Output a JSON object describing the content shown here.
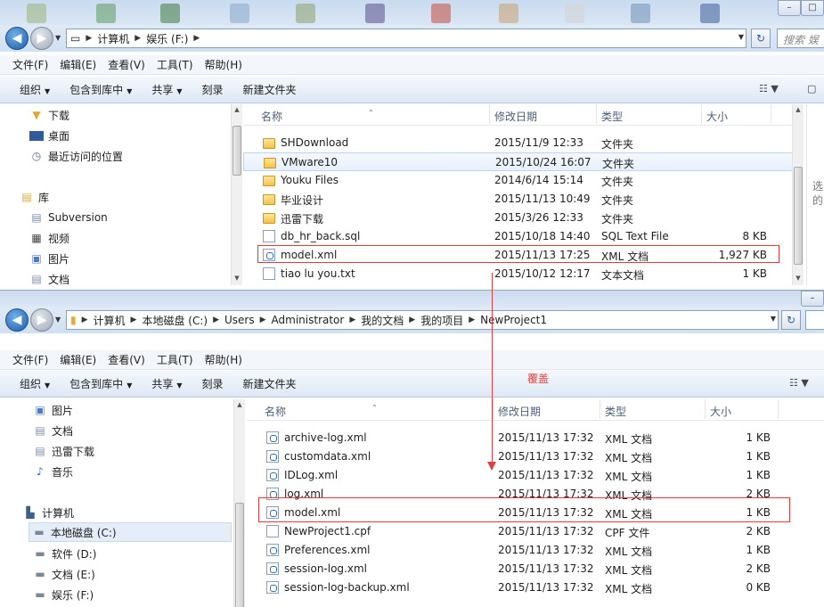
{
  "window1": {
    "address": [
      "计算机",
      "娱乐 (F:)"
    ],
    "search_placeholder": "搜索 娱",
    "menu": [
      "文件(F)",
      "编辑(E)",
      "查看(V)",
      "工具(T)",
      "帮助(H)"
    ],
    "toolbar": {
      "organize": "组织",
      "include": "包含到库中",
      "share": "共享",
      "burn": "刻录",
      "new_folder": "新建文件夹"
    },
    "nav_items": [
      {
        "label": "下载",
        "icon": "download-folder-icon"
      },
      {
        "label": "桌面",
        "icon": "desktop-icon"
      },
      {
        "label": "最近访问的位置",
        "icon": "recent-places-icon"
      },
      {
        "label": "库",
        "icon": "library-icon"
      },
      {
        "label": "Subversion",
        "icon": "document-library-icon"
      },
      {
        "label": "视频",
        "icon": "video-library-icon"
      },
      {
        "label": "图片",
        "icon": "picture-library-icon"
      },
      {
        "label": "文档",
        "icon": "document-library-icon"
      }
    ],
    "columns": {
      "name": "名称",
      "modified": "修改日期",
      "type": "类型",
      "size": "大小"
    },
    "files": [
      {
        "name": "SHDownload",
        "modified": "2015/11/9 12:33",
        "type": "文件夹",
        "size": "",
        "kind": "folder"
      },
      {
        "name": "VMware10",
        "modified": "2015/10/24 16:07",
        "type": "文件夹",
        "size": "",
        "kind": "folder"
      },
      {
        "name": "Youku Files",
        "modified": "2014/6/14 15:14",
        "type": "文件夹",
        "size": "",
        "kind": "folder"
      },
      {
        "name": "毕业设计",
        "modified": "2015/11/13 10:49",
        "type": "文件夹",
        "size": "",
        "kind": "folder"
      },
      {
        "name": "迅雷下载",
        "modified": "2015/3/26 12:33",
        "type": "文件夹",
        "size": "",
        "kind": "folder"
      },
      {
        "name": "db_hr_back.sql",
        "modified": "2015/10/18 14:40",
        "type": "SQL Text File",
        "size": "8 KB",
        "kind": "doc"
      },
      {
        "name": "model.xml",
        "modified": "2015/11/13 17:25",
        "type": "XML 文档",
        "size": "1,927 KB",
        "kind": "xml"
      },
      {
        "name": "tiao lu you.txt",
        "modified": "2015/10/12 12:17",
        "type": "文本文档",
        "size": "1 KB",
        "kind": "doc"
      }
    ],
    "right_pane_text": [
      "选",
      "的"
    ]
  },
  "window2": {
    "address": [
      "计算机",
      "本地磁盘 (C:)",
      "Users",
      "Administrator",
      "我的文档",
      "我的项目",
      "NewProject1"
    ],
    "menu": [
      "文件(F)",
      "编辑(E)",
      "查看(V)",
      "工具(T)",
      "帮助(H)"
    ],
    "toolbar": {
      "organize": "组织",
      "include": "包含到库中",
      "share": "共享",
      "burn": "刻录",
      "new_folder": "新建文件夹"
    },
    "nav_items": [
      {
        "label": "图片",
        "icon": "picture-library-icon"
      },
      {
        "label": "文档",
        "icon": "document-library-icon"
      },
      {
        "label": "迅雷下载",
        "icon": "document-library-icon"
      },
      {
        "label": "音乐",
        "icon": "music-library-icon"
      },
      {
        "label": "计算机",
        "icon": "computer-icon"
      },
      {
        "label": "本地磁盘 (C:)",
        "icon": "system-drive-icon"
      },
      {
        "label": "软件 (D:)",
        "icon": "drive-icon"
      },
      {
        "label": "文档 (E:)",
        "icon": "drive-icon"
      },
      {
        "label": "娱乐 (F:)",
        "icon": "drive-icon"
      }
    ],
    "columns": {
      "name": "名称",
      "modified": "修改日期",
      "type": "类型",
      "size": "大小"
    },
    "files": [
      {
        "name": "archive-log.xml",
        "modified": "2015/11/13 17:32",
        "type": "XML 文档",
        "size": "1 KB",
        "kind": "xml"
      },
      {
        "name": "customdata.xml",
        "modified": "2015/11/13 17:32",
        "type": "XML 文档",
        "size": "1 KB",
        "kind": "xml"
      },
      {
        "name": "IDLog.xml",
        "modified": "2015/11/13 17:32",
        "type": "XML 文档",
        "size": "1 KB",
        "kind": "xml"
      },
      {
        "name": "log.xml",
        "modified": "2015/11/13 17:32",
        "type": "XML 文档",
        "size": "2 KB",
        "kind": "xml"
      },
      {
        "name": "model.xml",
        "modified": "2015/11/13 17:32",
        "type": "XML 文档",
        "size": "1 KB",
        "kind": "xml"
      },
      {
        "name": "NewProject1.cpf",
        "modified": "2015/11/13 17:32",
        "type": "CPF 文件",
        "size": "2 KB",
        "kind": "doc"
      },
      {
        "name": "Preferences.xml",
        "modified": "2015/11/13 17:32",
        "type": "XML 文档",
        "size": "1 KB",
        "kind": "xml"
      },
      {
        "name": "session-log.xml",
        "modified": "2015/11/13 17:32",
        "type": "XML 文档",
        "size": "2 KB",
        "kind": "xml"
      },
      {
        "name": "session-log-backup.xml",
        "modified": "2015/11/13 17:32",
        "type": "XML 文档",
        "size": "0 KB",
        "kind": "xml"
      }
    ]
  },
  "annotation": {
    "label": "覆盖",
    "color": "#e0403f"
  }
}
